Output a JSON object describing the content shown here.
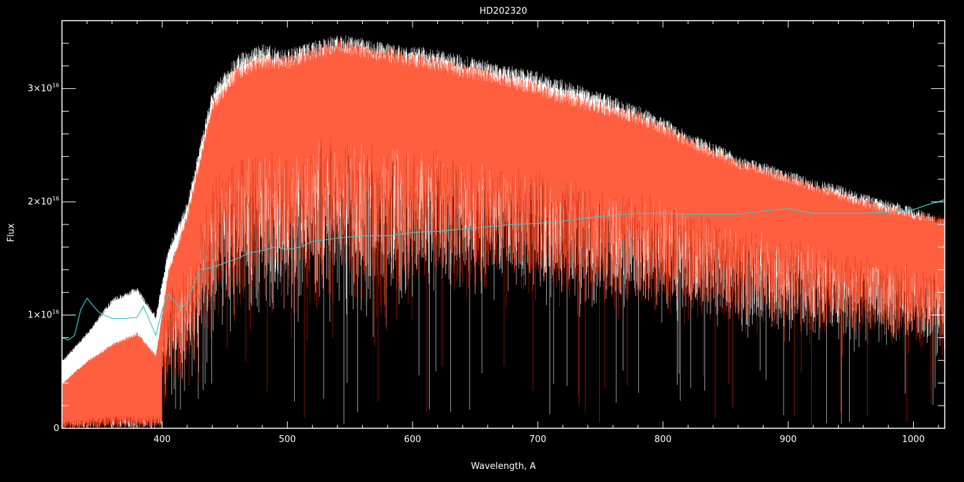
{
  "chart_data": {
    "type": "line",
    "title": "HD202320",
    "xlabel": "Wavelength, A",
    "ylabel": "Flux",
    "xlim": [
      320,
      1025
    ],
    "ylim": [
      0,
      3.6e+16
    ],
    "x_ticks": [
      400,
      500,
      600,
      700,
      800,
      900,
      1000
    ],
    "x_tick_labels": [
      "400",
      "500",
      "600",
      "700",
      "800",
      "900",
      "1000"
    ],
    "y_ticks": [
      0,
      1e+16,
      2e+16,
      3e+16
    ],
    "y_tick_labels": [
      {
        "base": "0",
        "exp": ""
      },
      {
        "base": "1×10",
        "exp": "16"
      },
      {
        "base": "2×10",
        "exp": "16"
      },
      {
        "base": "3×10",
        "exp": "16"
      }
    ],
    "grid": false,
    "legend": "none",
    "background": "#000000",
    "axis_color": "#ffffff",
    "series": [
      {
        "color": "#ffffff",
        "style": "dense-noisy-spectrum",
        "x": [
          320,
          340,
          360,
          380,
          395,
          405,
          420,
          440,
          460,
          480,
          500,
          520,
          540,
          560,
          580,
          600,
          620,
          640,
          660,
          680,
          700,
          720,
          740,
          760,
          780,
          800,
          820,
          840,
          850,
          860,
          880,
          900,
          920,
          940,
          960,
          980,
          1000,
          1025
        ],
        "values": [
          6000000000000000.0,
          8500000000000000.0,
          1.15e+16,
          1.25e+16,
          1e+16,
          1.6e+16,
          2e+16,
          3e+16,
          3.3e+16,
          3.4e+16,
          3.35e+16,
          3.42e+16,
          3.48e+16,
          3.45e+16,
          3.4e+16,
          3.38e+16,
          3.35e+16,
          3.3e+16,
          3.25e+16,
          3.2e+16,
          3.15e+16,
          3.08e+16,
          3e+16,
          2.93e+16,
          2.85e+16,
          2.75e+16,
          2.62e+16,
          2.52e+16,
          2.48e+16,
          2.4e+16,
          2.35e+16,
          2.28e+16,
          2.2e+16,
          2.15e+16,
          2.07e+16,
          2.02e+16,
          1.95e+16,
          1.85e+16
        ]
      },
      {
        "color": "#ff2a00",
        "style": "dense-noisy-spectrum",
        "x": [
          320,
          340,
          360,
          380,
          395,
          405,
          420,
          440,
          460,
          480,
          500,
          520,
          540,
          560,
          580,
          600,
          620,
          640,
          660,
          680,
          700,
          720,
          740,
          760,
          780,
          800,
          820,
          840,
          850,
          860,
          880,
          900,
          920,
          940,
          960,
          980,
          1000,
          1025
        ],
        "values": [
          4000000000000000.0,
          6000000000000000.0,
          7500000000000000.0,
          8500000000000000.0,
          6500000000000000.0,
          1.4e+16,
          1.9e+16,
          2.9e+16,
          3.2e+16,
          3.3e+16,
          3.3e+16,
          3.38e+16,
          3.45e+16,
          3.4e+16,
          3.36e+16,
          3.32e+16,
          3.28e+16,
          3.22e+16,
          3.18e+16,
          3.12e+16,
          3.05e+16,
          2.98e+16,
          2.92e+16,
          2.86e+16,
          2.8e+16,
          2.7e+16,
          2.58e+16,
          2.48e+16,
          2.44e+16,
          2.38e+16,
          2.32e+16,
          2.25e+16,
          2.17e+16,
          2.1e+16,
          2.03e+16,
          1.97e+16,
          1.92e+16,
          1.88e+16
        ]
      },
      {
        "color": "#33cccc",
        "style": "smooth",
        "x": [
          320,
          325,
          330,
          335,
          340,
          345,
          350,
          360,
          370,
          380,
          385,
          390,
          395,
          400,
          405,
          410,
          415,
          420,
          430,
          440,
          450,
          460,
          470,
          480,
          490,
          500,
          510,
          520,
          540,
          560,
          580,
          600,
          620,
          640,
          660,
          680,
          700,
          720,
          740,
          760,
          780,
          800,
          820,
          840,
          860,
          880,
          900,
          920,
          940,
          960,
          980,
          1000,
          1010,
          1020,
          1025
        ],
        "values": [
          8000000000000000.0,
          7800000000000000.0,
          8200000000000000.0,
          1.05e+16,
          1.15e+16,
          1.08e+16,
          1.02e+16,
          9700000000000000.0,
          9700000000000000.0,
          9800000000000000.0,
          1.08e+16,
          9500000000000000.0,
          8200000000000000.0,
          1.05e+16,
          1.18e+16,
          1.12e+16,
          1.05e+16,
          1.12e+16,
          1.4e+16,
          1.42e+16,
          1.46e+16,
          1.5e+16,
          1.55e+16,
          1.57e+16,
          1.6e+16,
          1.58e+16,
          1.6e+16,
          1.65e+16,
          1.68e+16,
          1.7e+16,
          1.7e+16,
          1.73e+16,
          1.74e+16,
          1.76e+16,
          1.78e+16,
          1.8e+16,
          1.81e+16,
          1.83e+16,
          1.86e+16,
          1.88e+16,
          1.9e+16,
          1.9e+16,
          1.89e+16,
          1.89e+16,
          1.89e+16,
          1.92e+16,
          1.94e+16,
          1.9e+16,
          1.9e+16,
          1.9e+16,
          1.91e+16,
          1.93e+16,
          1.97e+16,
          2e+16,
          2.02e+16
        ]
      }
    ]
  }
}
